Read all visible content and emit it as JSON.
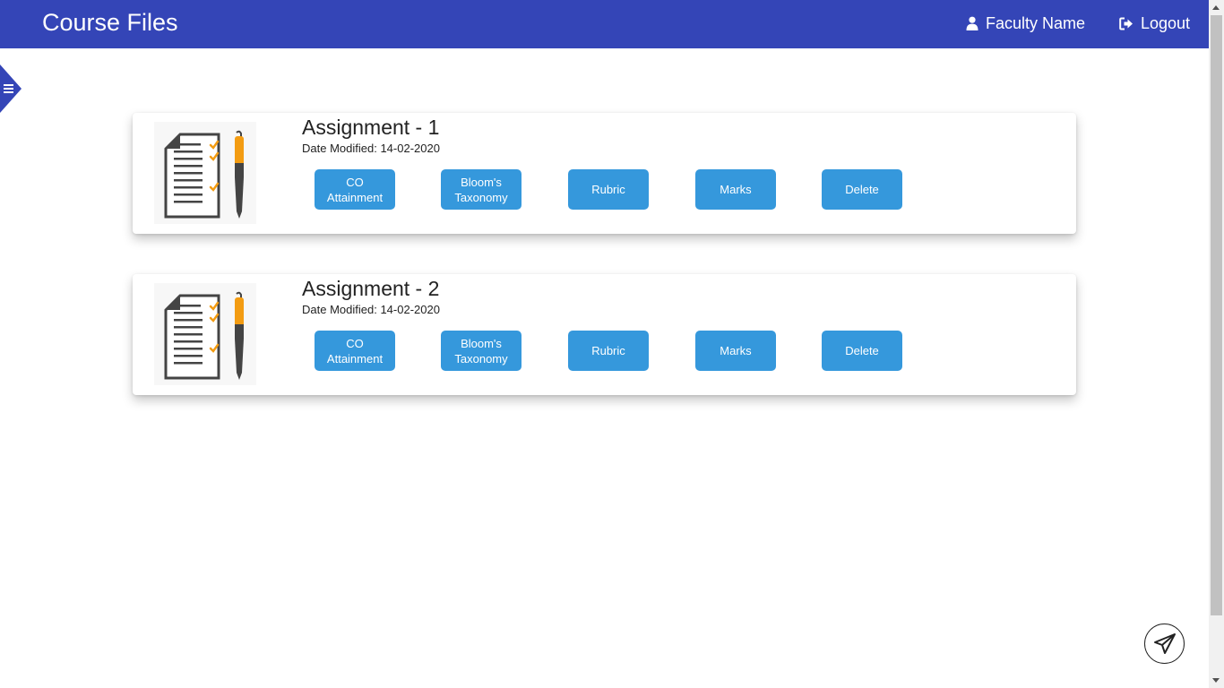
{
  "header": {
    "title": "Course Files",
    "user_label": "Faculty Name",
    "logout_label": "Logout"
  },
  "colors": {
    "header_bg": "#3445b7",
    "button_bg": "#3598dc",
    "checkmark": "#f39c12"
  },
  "icons": {
    "user": "user-icon",
    "logout": "sign-out-icon",
    "menu": "hamburger-icon",
    "send": "paper-plane-icon",
    "thumbnail": "checklist-document-icon"
  },
  "cards": [
    {
      "title": "Assignment - 1",
      "date_label": "Date Modified:",
      "date_value": "14-02-2020",
      "buttons": {
        "co": "CO Attainment",
        "bloom": "Bloom's Taxonomy",
        "rubric": "Rubric",
        "marks": "Marks",
        "delete": "Delete"
      }
    },
    {
      "title": "Assignment - 2",
      "date_label": "Date Modified:",
      "date_value": "14-02-2020",
      "buttons": {
        "co": "CO Attainment",
        "bloom": "Bloom's Taxonomy",
        "rubric": "Rubric",
        "marks": "Marks",
        "delete": "Delete"
      }
    }
  ]
}
